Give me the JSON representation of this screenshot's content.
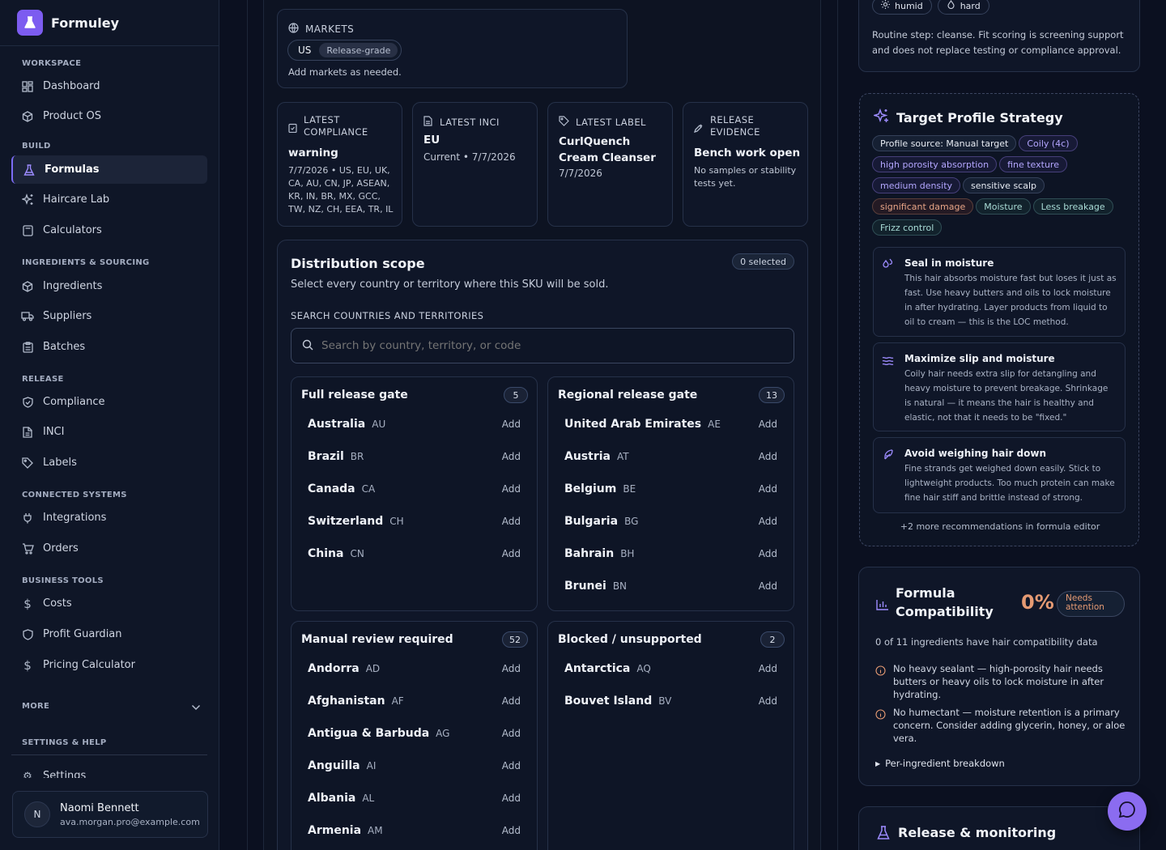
{
  "brand": {
    "name": "Formuley"
  },
  "sidebar": {
    "sections": [
      {
        "title": "WORKSPACE",
        "items": [
          {
            "label": "Dashboard",
            "icon": "dashboard-icon"
          },
          {
            "label": "Product OS",
            "icon": "cube-icon"
          }
        ]
      },
      {
        "title": "BUILD",
        "items": [
          {
            "label": "Formulas",
            "icon": "flask-icon",
            "active": true
          },
          {
            "label": "Haircare Lab",
            "icon": "sparkles-icon"
          },
          {
            "label": "Calculators",
            "icon": "calculator-icon"
          }
        ]
      },
      {
        "title": "INGREDIENTS & SOURCING",
        "items": [
          {
            "label": "Ingredients",
            "icon": "cube-icon"
          },
          {
            "label": "Suppliers",
            "icon": "truck-icon"
          },
          {
            "label": "Batches",
            "icon": "clipboard-icon"
          }
        ]
      },
      {
        "title": "RELEASE",
        "items": [
          {
            "label": "Compliance",
            "icon": "shield-check-icon"
          },
          {
            "label": "INCI",
            "icon": "document-icon"
          },
          {
            "label": "Labels",
            "icon": "tag-icon"
          }
        ]
      },
      {
        "title": "CONNECTED SYSTEMS",
        "items": [
          {
            "label": "Integrations",
            "icon": "plug-icon"
          },
          {
            "label": "Orders",
            "icon": "cart-icon"
          }
        ]
      },
      {
        "title": "BUSINESS TOOLS",
        "items": [
          {
            "label": "Costs",
            "icon": "dollar-icon"
          },
          {
            "label": "Profit Guardian",
            "icon": "shield-icon"
          },
          {
            "label": "Pricing Calculator",
            "icon": "dollar-icon"
          }
        ]
      }
    ],
    "more_label": "MORE",
    "settings_section": "SETTINGS & HELP",
    "settings_label": "Settings",
    "user": {
      "initial": "N",
      "name": "Naomi Bennett",
      "email": "ava.morgan.pro@example.com"
    }
  },
  "markets": {
    "title": "MARKETS",
    "chip_code": "US",
    "chip_status": "Release-grade",
    "hint": "Add markets as needed."
  },
  "summary_cards": [
    {
      "label_line1": "LATEST",
      "label_line2": "COMPLIANCE",
      "icon": "clipboard-check-icon",
      "value": "warning",
      "detail": "7/7/2026 • US, EU, UK, CA, AU, CN, JP, ASEAN, KR, IN, BR, MX, GCC, TW, NZ, CH, EEA, TR, IL"
    },
    {
      "label_line1": "LATEST INCI",
      "label_line2": "",
      "icon": "document-icon",
      "value": "EU",
      "detail": "Current • 7/7/2026"
    },
    {
      "label_line1": "LATEST LABEL",
      "label_line2": "",
      "icon": "tag-icon",
      "value": "CurlQuench Cream Cleanser",
      "detail": "7/7/2026"
    },
    {
      "label_line1": "RELEASE",
      "label_line2": "EVIDENCE",
      "icon": "pipette-icon",
      "value": "Bench work open",
      "detail": "No samples or stability tests yet."
    }
  ],
  "distribution": {
    "title": "Distribution scope",
    "selected_badge": "0 selected",
    "subtitle": "Select every country or territory where this SKU will be sold.",
    "search_label": "SEARCH COUNTRIES AND TERRITORIES",
    "search_placeholder": "Search by country, territory, or code",
    "add_label": "Add",
    "gates": [
      {
        "title": "Full release gate",
        "count": "5",
        "countries": [
          {
            "name": "Australia",
            "code": "AU"
          },
          {
            "name": "Brazil",
            "code": "BR"
          },
          {
            "name": "Canada",
            "code": "CA"
          },
          {
            "name": "Switzerland",
            "code": "CH"
          },
          {
            "name": "China",
            "code": "CN"
          }
        ]
      },
      {
        "title": "Regional release gate",
        "count": "13",
        "countries": [
          {
            "name": "United Arab Emirates",
            "code": "AE"
          },
          {
            "name": "Austria",
            "code": "AT"
          },
          {
            "name": "Belgium",
            "code": "BE"
          },
          {
            "name": "Bulgaria",
            "code": "BG"
          },
          {
            "name": "Bahrain",
            "code": "BH"
          },
          {
            "name": "Brunei",
            "code": "BN"
          }
        ]
      },
      {
        "title": "Manual review required",
        "count": "52",
        "countries": [
          {
            "name": "Andorra",
            "code": "AD"
          },
          {
            "name": "Afghanistan",
            "code": "AF"
          },
          {
            "name": "Antigua & Barbuda",
            "code": "AG"
          },
          {
            "name": "Anguilla",
            "code": "AI"
          },
          {
            "name": "Albania",
            "code": "AL"
          },
          {
            "name": "Armenia",
            "code": "AM"
          }
        ]
      },
      {
        "title": "Blocked / unsupported",
        "count": "2",
        "countries": [
          {
            "name": "Antarctica",
            "code": "AQ"
          },
          {
            "name": "Bouvet Island",
            "code": "BV"
          }
        ]
      }
    ]
  },
  "routine": {
    "chips": [
      "humid",
      "hard"
    ],
    "note": "Routine step: cleanse. Fit scoring is screening support and does not replace testing or compliance approval."
  },
  "target_profile": {
    "title": "Target Profile Strategy",
    "tags": [
      {
        "text": "Profile source: Manual target",
        "tone": "neutral"
      },
      {
        "text": "Coily (4c)",
        "tone": "violet"
      },
      {
        "text": "high porosity absorption",
        "tone": "violet"
      },
      {
        "text": "fine texture",
        "tone": "violet"
      },
      {
        "text": "medium density",
        "tone": "violet"
      },
      {
        "text": "sensitive scalp",
        "tone": "neutral"
      },
      {
        "text": "significant damage",
        "tone": "amber"
      },
      {
        "text": "Moisture",
        "tone": "teal"
      },
      {
        "text": "Less breakage",
        "tone": "teal"
      },
      {
        "text": "Frizz control",
        "tone": "teal"
      }
    ],
    "recommendations": [
      {
        "icon": "droplets-icon",
        "title": "Seal in moisture",
        "body": "This hair absorbs moisture fast but loses it just as fast. Use heavy butters and oils to lock moisture in after hydrating. Layer products from liquid to oil to cream — this is the LOC method."
      },
      {
        "icon": "waves-icon",
        "title": "Maximize slip and moisture",
        "body": "Coily hair needs extra slip for detangling and heavy moisture to prevent breakage. Shrinkage is natural — it means the hair is healthy and elastic, not that it needs to be \"fixed.\""
      },
      {
        "icon": "feather-icon",
        "title": "Avoid weighing hair down",
        "body": "Fine strands get weighed down easily. Stick to lightweight products. Too much protein can make fine hair stiff and brittle instead of strong."
      }
    ],
    "more_note": "+2 more recommendations in formula editor"
  },
  "compatibility": {
    "title_line1": "Formula",
    "title_line2": "Compatibility",
    "percent": "0%",
    "status_line1": "Needs",
    "status_line2": "attention",
    "summary": "0 of 11 ingredients have hair compatibility data",
    "warnings": [
      "No heavy sealant — high-porosity hair needs butters or heavy oils to lock moisture in after hydrating.",
      "No humectant — moisture retention is a primary concern. Consider adding glycerin, honey, or aloe vera."
    ],
    "breakdown_label": "Per-ingredient breakdown"
  },
  "release_monitoring": {
    "title": "Release & monitoring"
  },
  "colors": {
    "accent": "#7c5cf0",
    "amber": "#e59a73",
    "violet": "#a999ff",
    "teal": "#9fd8d2"
  }
}
